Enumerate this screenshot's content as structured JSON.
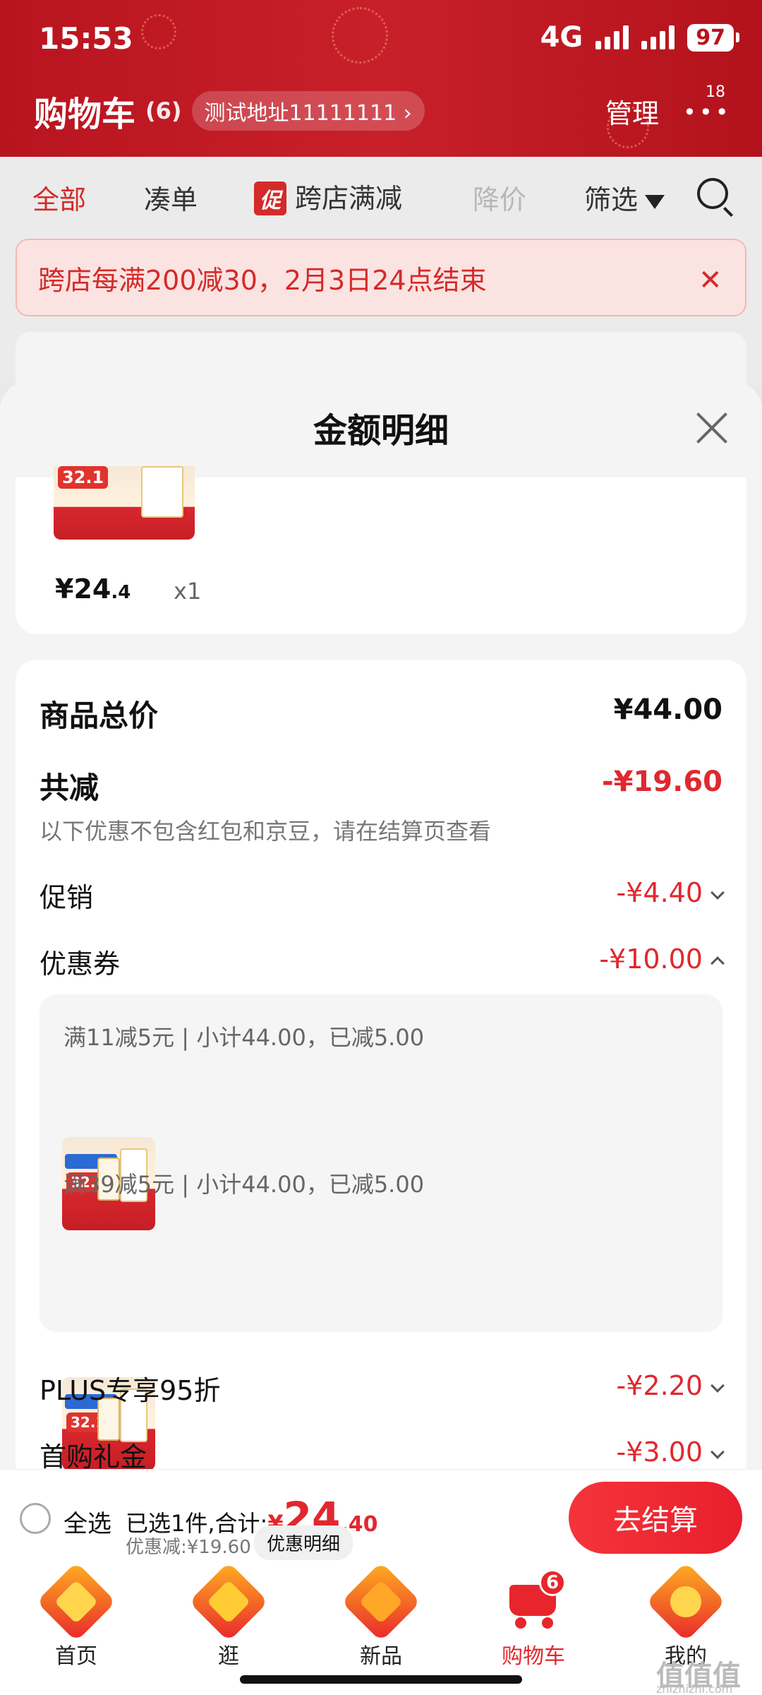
{
  "status": {
    "time": "15:53",
    "network": "4G",
    "battery": "97"
  },
  "header": {
    "title": "购物车",
    "count": "(6)",
    "address": "测试地址11111111 ›",
    "manage": "管理",
    "more_badge": "18"
  },
  "tabs": [
    {
      "label": "全部",
      "state": "active"
    },
    {
      "label": "凑单",
      "state": "normal"
    },
    {
      "label": "跨店满减",
      "tag": "促",
      "state": "normal"
    },
    {
      "label": "降价",
      "state": "disabled"
    },
    {
      "label": "筛选",
      "state": "normal"
    }
  ],
  "banner": {
    "text": "跨店每满200减30，2月3日24点结束"
  },
  "sheet": {
    "title": "金额明细",
    "item": {
      "price_main": "¥24",
      "price_dec": ".4",
      "qty": "x1",
      "badge": "32.1"
    },
    "total_label": "商品总价",
    "total_value": "¥44.00",
    "discount_label": "共减",
    "discount_value": "-¥19.60",
    "discount_note": "以下优惠不包含红包和京豆，请在结算页查看",
    "rows": [
      {
        "label": "促销",
        "value": "-¥4.40",
        "chevron": "down"
      },
      {
        "label": "优惠券",
        "value": "-¥10.00",
        "chevron": "up"
      },
      {
        "label": "PLUS专享95折",
        "value": "-¥2.20",
        "chevron": "down"
      },
      {
        "label": "首购礼金",
        "value": "-¥3.00",
        "chevron": "down"
      }
    ],
    "coupons": [
      {
        "text": "满11减5元 | 小计44.00，已减5.00",
        "badge": "32.1"
      },
      {
        "text": "满39减5元 | 小计44.00，已减5.00",
        "badge": "32.1"
      }
    ]
  },
  "checkout": {
    "select_all": "全选",
    "selected_prefix": "已选1件,合计:",
    "total_symbol": "¥",
    "total_int": "24",
    "total_dec": ".40",
    "discount_text": "优惠减:¥19.60",
    "detail_button": "优惠明细",
    "button": "去结算"
  },
  "nav": [
    {
      "label": "首页",
      "icon": "home-icon"
    },
    {
      "label": "逛",
      "icon": "browse-icon"
    },
    {
      "label": "新品",
      "icon": "new-icon"
    },
    {
      "label": "购物车",
      "icon": "cart-icon",
      "badge": "6",
      "active": true
    },
    {
      "label": "我的",
      "icon": "profile-icon"
    }
  ],
  "watermark": {
    "main": "值值值",
    "sub": "zhizhizhi.com"
  },
  "colors": {
    "brand_red": "#e0282e",
    "header_red": "#b8141f"
  }
}
